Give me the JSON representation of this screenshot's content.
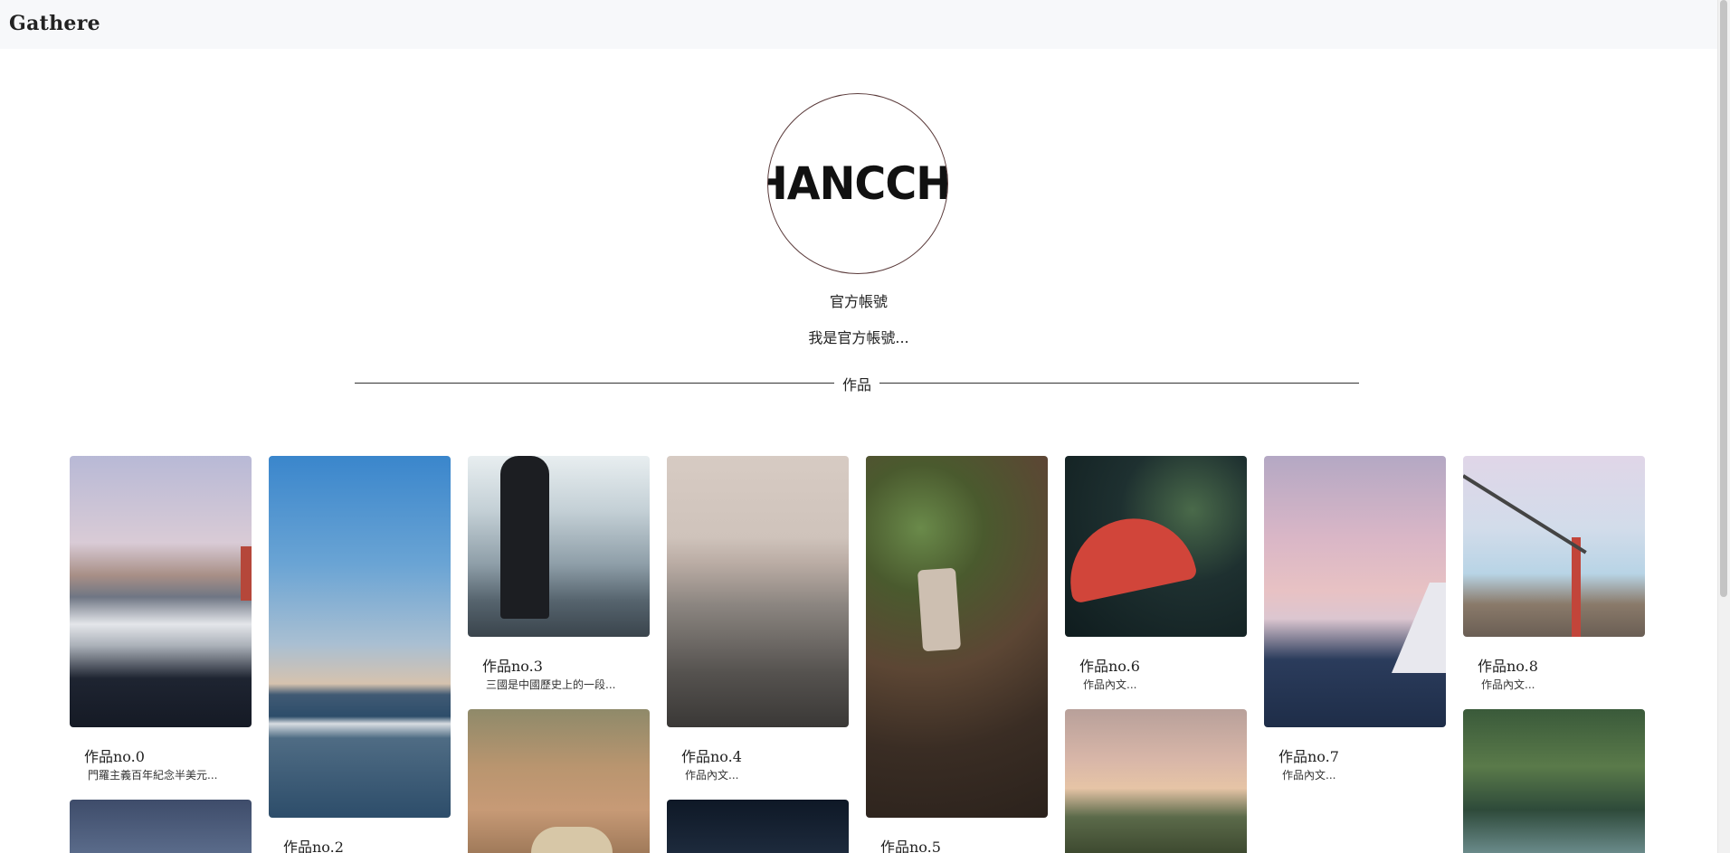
{
  "app": {
    "brand": "Gathere"
  },
  "profile": {
    "avatar_logo_text": "HANCCHUN",
    "name": "官方帳號",
    "bio": "我是官方帳號..."
  },
  "section": {
    "works_label": "作品"
  },
  "works": [
    {
      "title": "作品no.0",
      "desc": "門羅主義百年紀念半美元..."
    },
    {
      "title": "作品no.2",
      "desc": ""
    },
    {
      "title": "作品no.3",
      "desc": "三國是中國歷史上的一段..."
    },
    {
      "title": "作品no.4",
      "desc": "作品內文..."
    },
    {
      "title": "作品no.5",
      "desc": ""
    },
    {
      "title": "作品no.6",
      "desc": "作品內文..."
    },
    {
      "title": "作品no.7",
      "desc": "作品內文..."
    },
    {
      "title": "作品no.8",
      "desc": "作品內文..."
    }
  ],
  "colors": {
    "topbar_bg": "#f7f8fa",
    "avatar_border": "#5a3a3a",
    "divider": "#333333"
  }
}
